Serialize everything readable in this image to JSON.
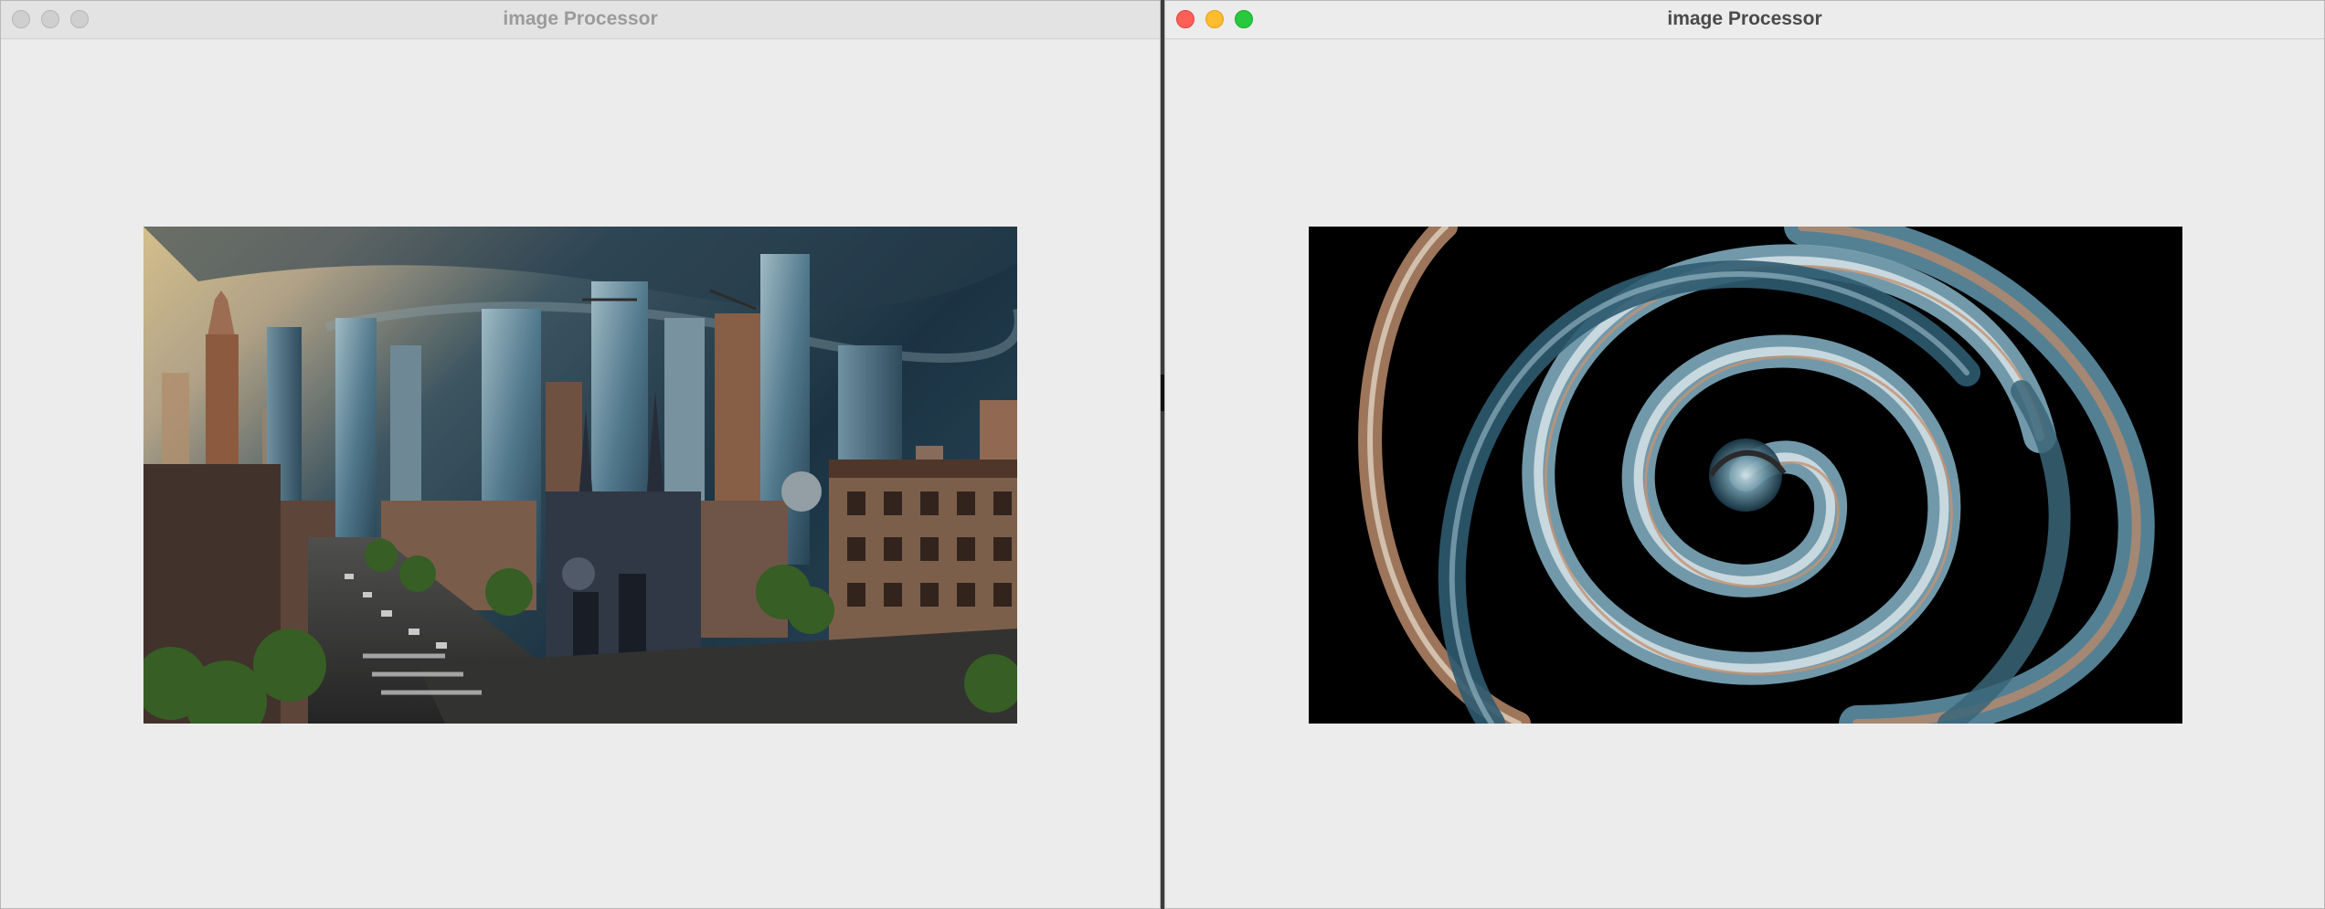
{
  "windows": {
    "left": {
      "title": "image Processor",
      "active": false
    },
    "right": {
      "title": "image Processor",
      "active": true
    }
  },
  "icons": {
    "close": "close-icon",
    "minimize": "minimize-icon",
    "maximize": "maximize-icon"
  },
  "colors": {
    "close": "#fe5f57",
    "minimize": "#febc2e",
    "maximize": "#28c840",
    "window_bg": "#ececec"
  }
}
